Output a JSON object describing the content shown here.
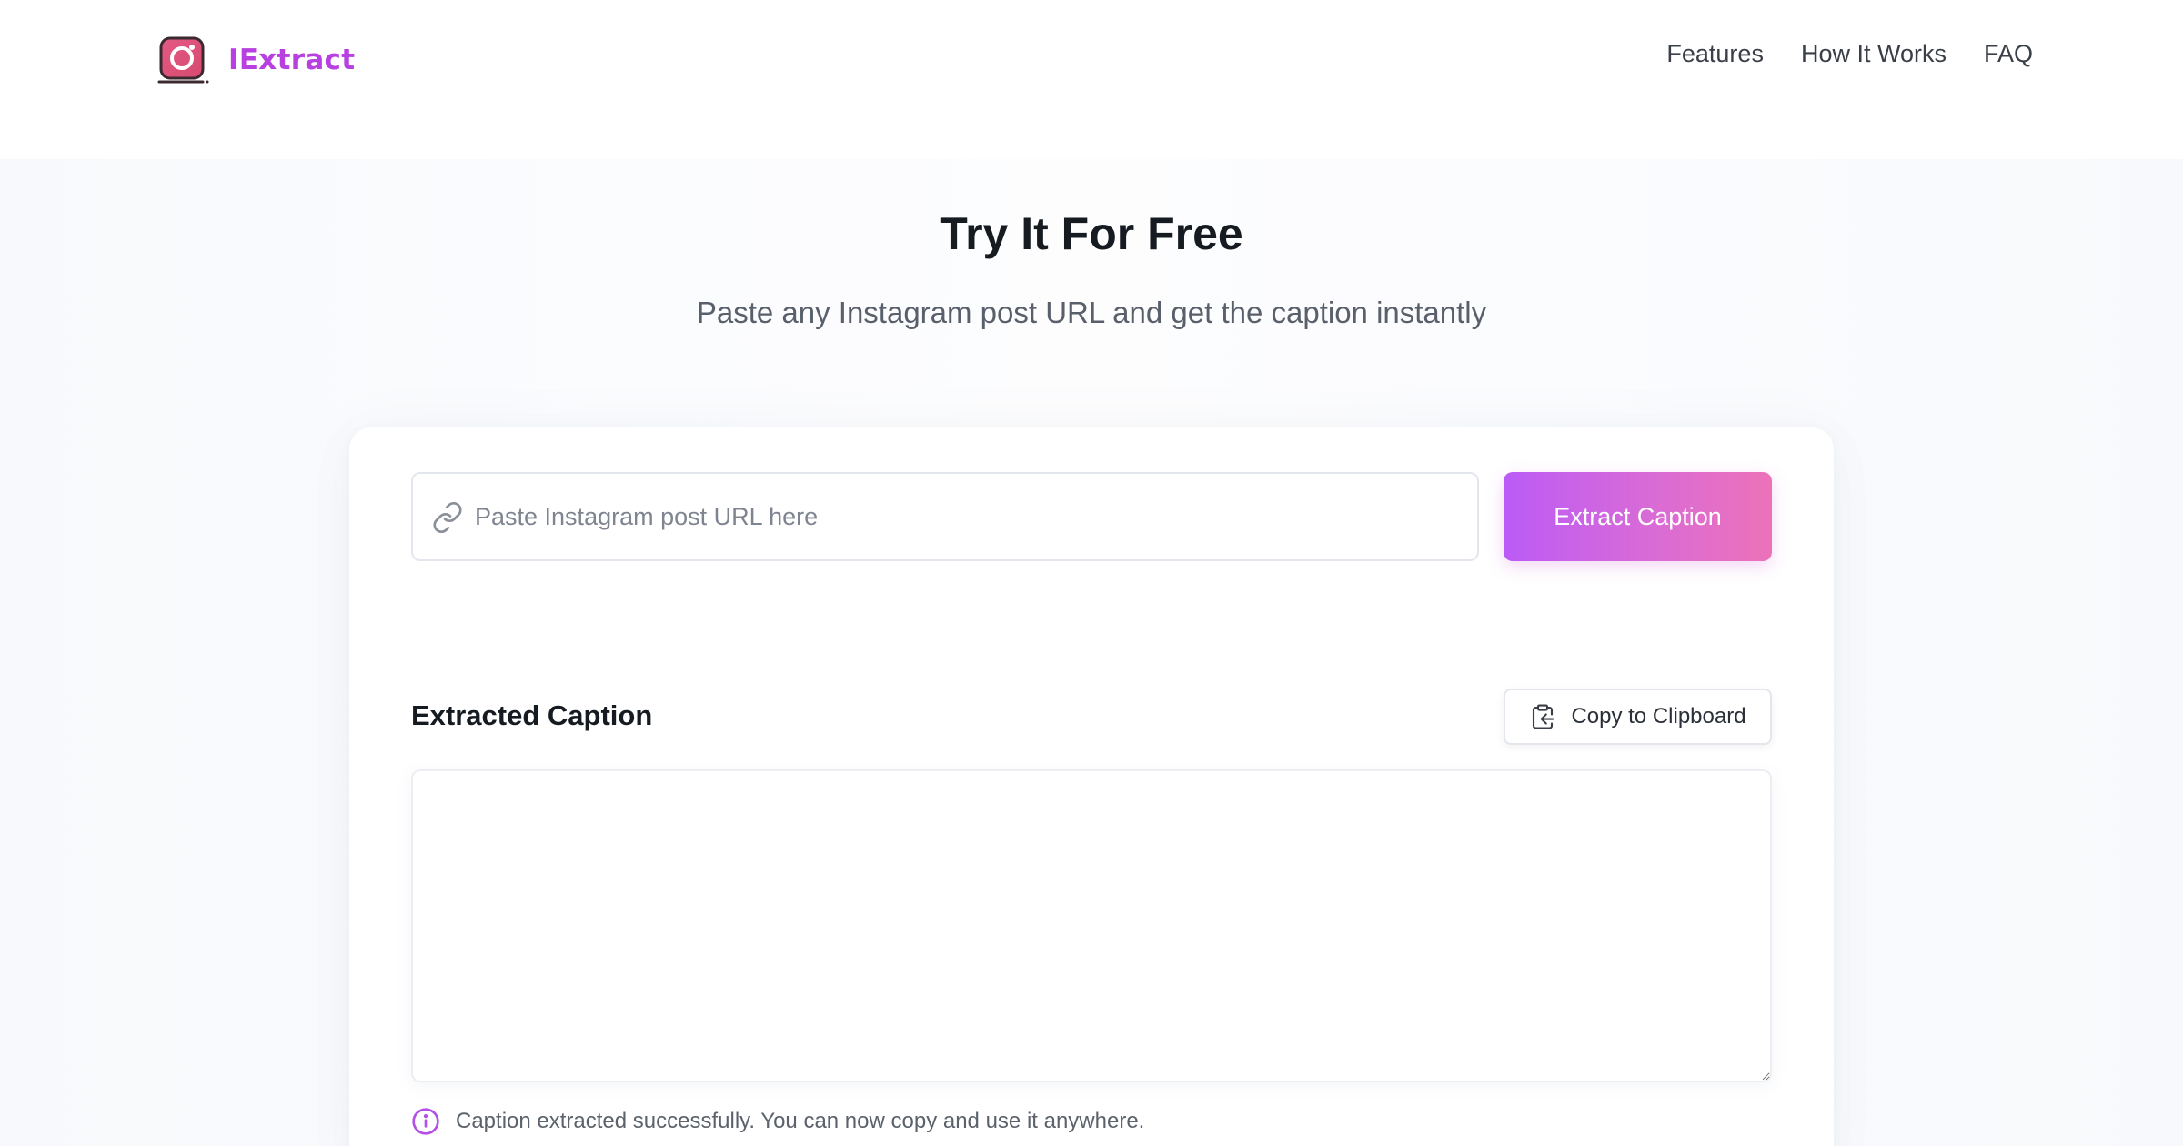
{
  "brand": {
    "name": "IExtract",
    "logo_icon": "instagram-camera-icon",
    "accent_color": "#b83fe0"
  },
  "nav": {
    "items": [
      {
        "label": "Features"
      },
      {
        "label": "How It Works"
      },
      {
        "label": "FAQ"
      }
    ]
  },
  "hero": {
    "title": "Try It For Free",
    "subtitle": "Paste any Instagram post URL and get the caption instantly"
  },
  "extractor": {
    "url_input": {
      "placeholder": "Paste Instagram post URL here",
      "value": "",
      "icon": "link-icon"
    },
    "extract_button_label": "Extract Caption",
    "button_gradient": [
      "#bb5bf6",
      "#ec72b8"
    ]
  },
  "result": {
    "heading": "Extracted Caption",
    "copy_button_label": "Copy to Clipboard",
    "copy_icon": "clipboard-icon",
    "caption_text": "",
    "status_icon": "info-icon",
    "status_message": "Caption extracted successfully. You can now copy and use it anywhere."
  }
}
